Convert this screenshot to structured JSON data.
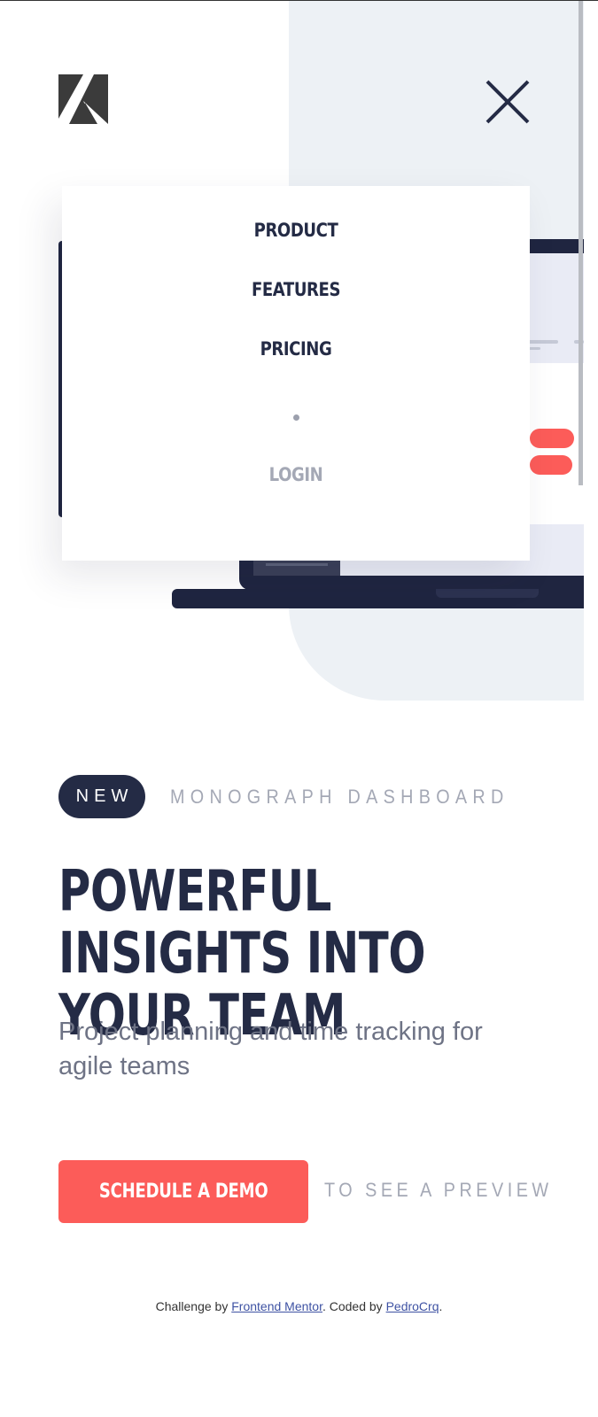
{
  "header": {
    "logo_icon": "monograph-logo-icon",
    "close_icon": "close-icon"
  },
  "menu": {
    "items": [
      {
        "label": "PRODUCT"
      },
      {
        "label": "FEATURES"
      },
      {
        "label": "PRICING"
      }
    ],
    "login_label": "LOGIN"
  },
  "hero": {
    "badge": "NEW",
    "tag": "MONOGRAPH DASHBOARD",
    "headline": "POWERFUL INSIGHTS INTO YOUR TEAM",
    "subheadline": "Project planning and time tracking for agile teams",
    "cta_label": "SCHEDULE A DEMO",
    "cta_note": "TO SEE A PREVIEW"
  },
  "footer": {
    "prefix": "Challenge by",
    "link1": "Frontend Mentor",
    "middle": ". Coded by",
    "link2": "PedroCrq",
    "suffix": "."
  },
  "colors": {
    "accent": "#fc5c59",
    "navy": "#242b45",
    "muted": "#a4a8b5",
    "hero_bg": "#edf1f5"
  }
}
